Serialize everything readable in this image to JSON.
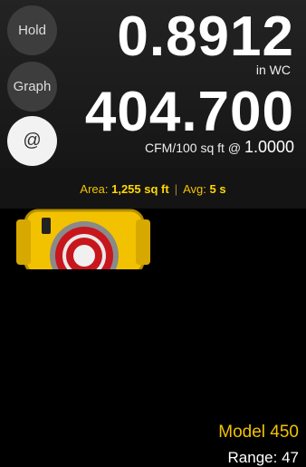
{
  "buttons": {
    "hold_label": "Hold",
    "graph_label": "Graph",
    "at_label": "@"
  },
  "readings": {
    "pressure_value": "0.8912",
    "pressure_unit": "in WC",
    "flow_value": "404.700",
    "flow_unit": "CFM/100 sq ft @",
    "flow_exponent": "1.0000"
  },
  "info_bar": {
    "area_label": "Area:",
    "area_value": "1,255 sq ft",
    "separator": "|",
    "avg_label": "Avg:",
    "avg_value": "5 s"
  },
  "device": {
    "model": "Model 450",
    "range_label": "Range:",
    "range_value": "47",
    "body_color": "#f2c200",
    "accent_color": "#c8161d"
  }
}
